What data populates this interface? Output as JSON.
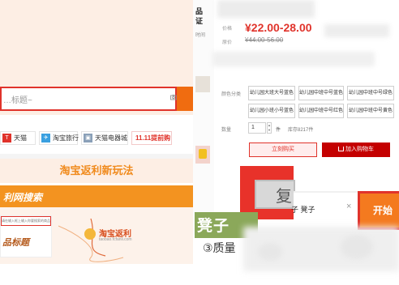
{
  "left_panel": {
    "search": {
      "placeholder": "…标题~"
    },
    "quick_links": [
      {
        "icon": "tmall-icon",
        "label": "天猫",
        "color": "#e0332b"
      },
      {
        "icon": "travel-icon",
        "label": "淘宝旅行",
        "color": "#3aa0e0"
      },
      {
        "icon": "tmall-electronics-icon",
        "label": "天猫电器城",
        "color": "#8aa0b8"
      }
    ],
    "promo_link": "11.11提前购",
    "section_title": "淘宝返利新玩法",
    "banner_text": "利网搜索",
    "mini": {
      "search_text": "请在输入框上输入你要搜索的商品标题",
      "title": "品标题",
      "logo_text": "淘宝返利",
      "logo_url": "taobao.fcfanli.com"
    }
  },
  "center_strip": {
    "labels": [
      "品",
      "证"
    ],
    "time_label": "时间"
  },
  "product": {
    "price_label": "价格",
    "price": "¥22.00-28.00",
    "orig_price_label": "原价",
    "orig_price": "¥44.00-56.00",
    "attr_label": "颜色分类",
    "options": [
      "幼儿园大班大号蓝色",
      "幼儿园中班中号蓝色",
      "幼儿园中班中号绿色",
      "幼儿园小班小号蓝色",
      "幼儿园中班中号红色",
      "幼儿园中班中号黄色"
    ],
    "qty_label": "数量",
    "qty_value": "1",
    "qty_unit": "件",
    "stock": "库存8217件",
    "buy_now": "立刻购买",
    "add_cart": "加入购物车"
  },
  "zoom": {
    "gray_text": "复",
    "query": "子 凳子",
    "clear_icon": "×",
    "button": "开始"
  },
  "label": {
    "green": "凳子",
    "quality": "③质量"
  },
  "colors": {
    "accent_red": "#e0332b",
    "accent_orange": "#f39320",
    "peach": "#fdeee4"
  }
}
